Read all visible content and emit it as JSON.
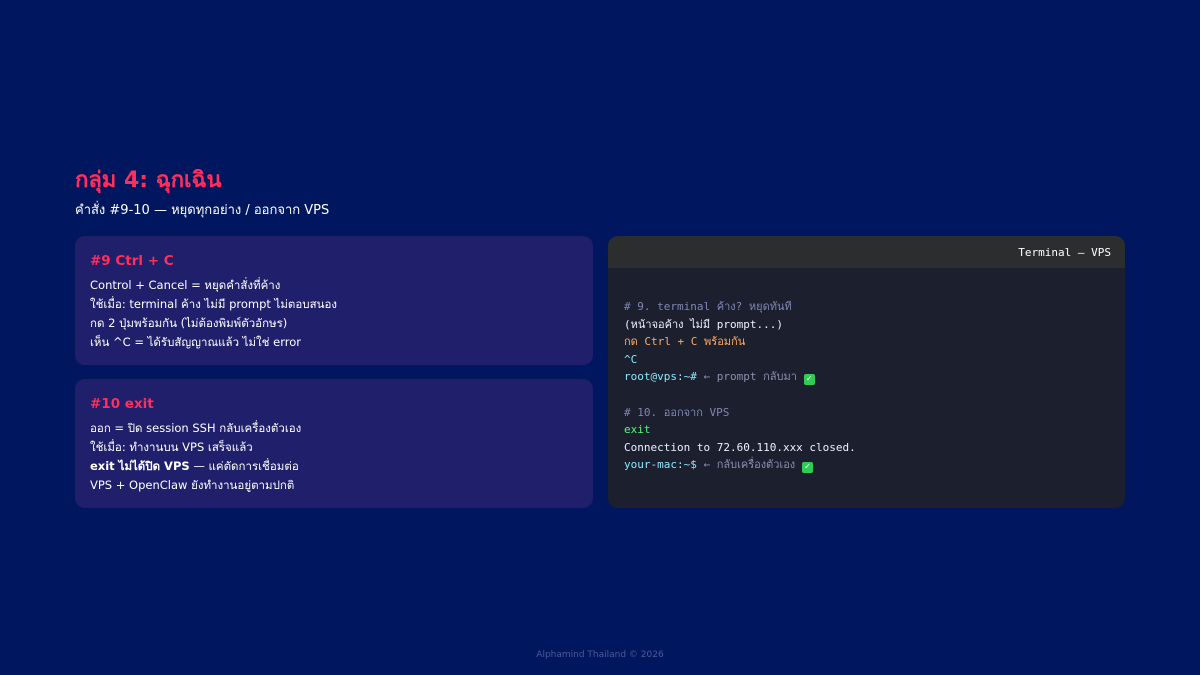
{
  "header": {
    "title": "กลุ่ม 4: ฉุกเฉิน",
    "subtitle": "คำสั่ง #9-10 — หยุดทุกอย่าง / ออกจาก VPS"
  },
  "cards": [
    {
      "title": "#9 Ctrl + C",
      "lines": [
        "Control + Cancel = หยุดคำสั่งที่ค้าง",
        "ใช้เมื่อ: terminal ค้าง ไม่มี prompt ไม่ตอบสนอง",
        "กด 2 ปุ่มพร้อมกัน (ไม่ต้องพิมพ์ตัวอักษร)",
        "เห็น ^C = ได้รับสัญญาณแล้ว ไม่ใช่ error"
      ]
    },
    {
      "title": "#10 exit",
      "lines": [
        "ออก = ปิด session SSH กลับเครื่องตัวเอง",
        "ใช้เมื่อ: ทำงานบน VPS เสร็จแล้ว",
        "",
        "VPS + OpenClaw ยังทำงานอยู่ตามปกติ"
      ],
      "bold_prefix": "exit ไม่ได้ปิด VPS",
      "bold_rest": " — แค่ตัดการเชื่อมต่อ"
    }
  ],
  "terminal": {
    "title": "Terminal — VPS",
    "lines": [
      "# 9. terminal ค้าง? หยุดทันที",
      "(หน้าจอค้าง ไม่มี prompt...)",
      "กด Ctrl + C พร้อมกัน",
      "^C",
      "root@vps:~#",
      " ← prompt กลับมา ",
      "",
      "# 10. ออกจาก VPS",
      "exit",
      "Connection to 72.60.110.xxx closed.",
      "your-mac:~$",
      " ← กลับเครื่องตัวเอง "
    ],
    "check_icon": "check-mark-icon"
  },
  "footer": {
    "text": "Alphamind Thailand © 2026"
  },
  "colors": {
    "background": "#00175f",
    "accent": "#ff2e5b",
    "card": "#1f1f6c",
    "terminal_bg": "#1c1f2d"
  }
}
